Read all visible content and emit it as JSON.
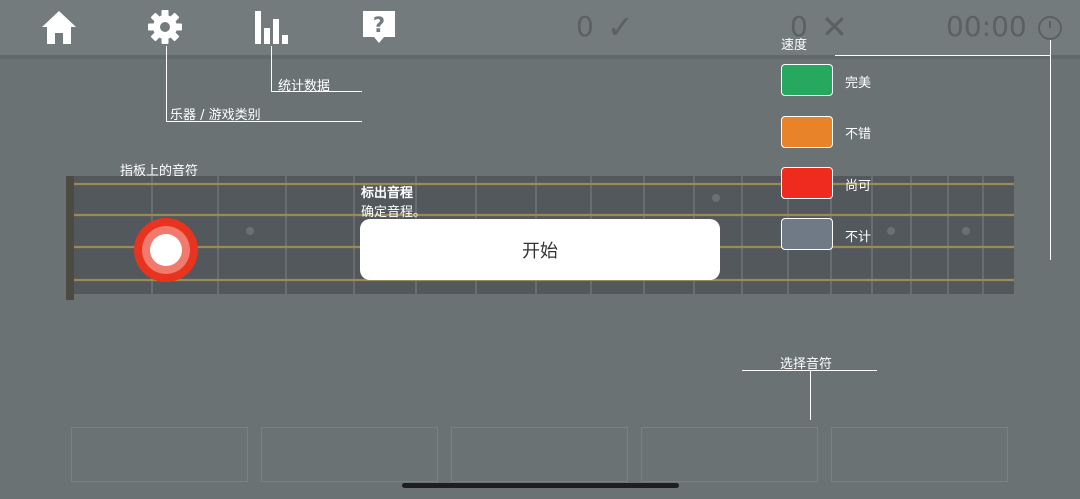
{
  "topbar": {
    "icons": [
      "home-icon",
      "gear-icon",
      "stats-icon",
      "help-icon"
    ],
    "correct_count": "0",
    "wrong_count": "0",
    "timer": "00:00"
  },
  "annotations": {
    "stats": "统计数据",
    "instrument": "乐器 / 游戏类别",
    "fret_note": "指板上的音符",
    "choose_note": "选择音符"
  },
  "overlay": {
    "title": "标出音程",
    "subtitle": "确定音程。",
    "start_label": "开始"
  },
  "speed_legend": {
    "title": "速度",
    "items": [
      {
        "label": "完美",
        "color": "#27a85f"
      },
      {
        "label": "不错",
        "color": "#e8832a"
      },
      {
        "label": "尚可",
        "color": "#ef2b1f"
      },
      {
        "label": "不计",
        "color": "#6f7a86"
      }
    ]
  },
  "colors": {
    "accent_marker": "#e8341f",
    "fretboard": "#52585c",
    "string": "#9a8a55"
  },
  "answer_choices": [
    "",
    "",
    "",
    "",
    ""
  ]
}
